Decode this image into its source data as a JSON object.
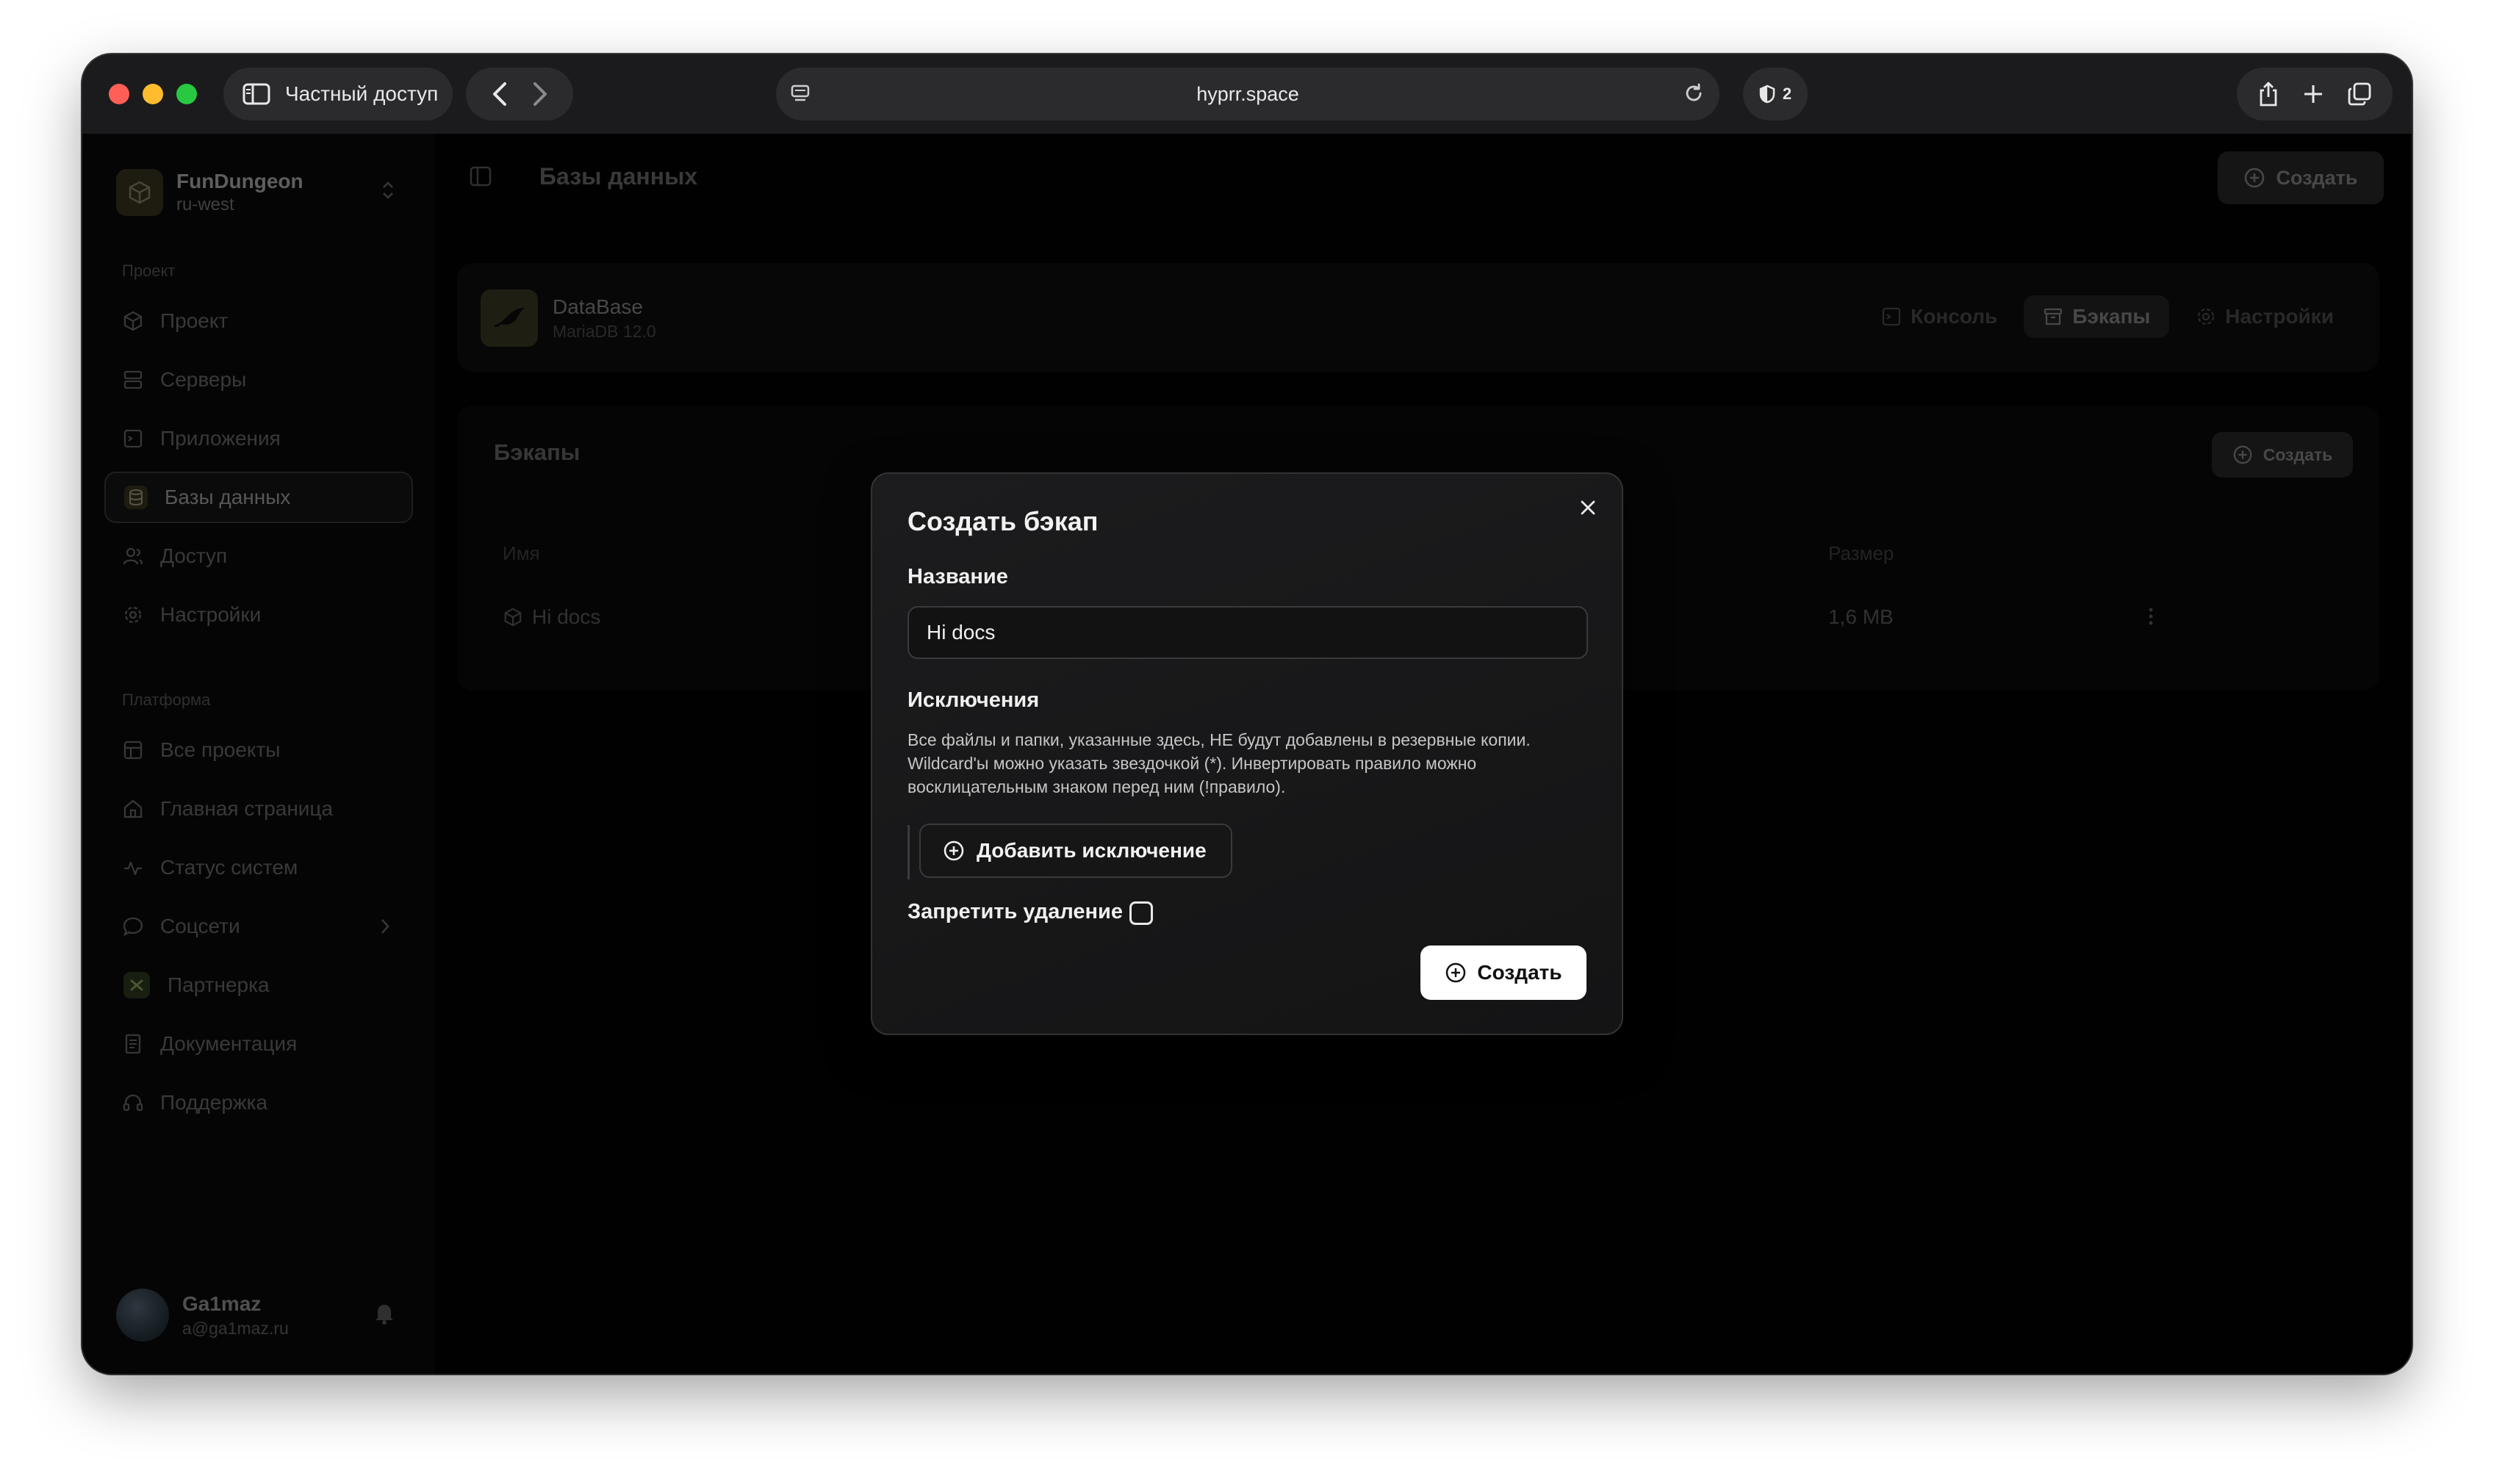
{
  "browser": {
    "sidebar_label": "Частный доступ",
    "url": "hyprr.space",
    "shield_count": "2"
  },
  "workspace": {
    "name": "FunDungeon",
    "region": "ru-west"
  },
  "sidebar": {
    "project_section": "Проект",
    "project_items": [
      {
        "label": "Проект",
        "icon": "cube-icon"
      },
      {
        "label": "Серверы",
        "icon": "server-icon"
      },
      {
        "label": "Приложения",
        "icon": "app-icon"
      },
      {
        "label": "Базы данных",
        "icon": "database-icon",
        "active": true
      },
      {
        "label": "Доступ",
        "icon": "users-icon"
      },
      {
        "label": "Настройки",
        "icon": "gear-icon"
      }
    ],
    "platform_section": "Платформа",
    "platform_items": [
      {
        "label": "Все проекты",
        "icon": "grid-icon"
      },
      {
        "label": "Главная страница",
        "icon": "home-icon"
      },
      {
        "label": "Статус систем",
        "icon": "activity-icon"
      },
      {
        "label": "Соцсети",
        "icon": "chat-icon"
      },
      {
        "label": "Партнерка",
        "icon": "partner-icon"
      },
      {
        "label": "Документация",
        "icon": "doc-icon"
      },
      {
        "label": "Поддержка",
        "icon": "headset-icon"
      }
    ]
  },
  "user": {
    "name": "Ga1maz",
    "email": "a@ga1maz.ru"
  },
  "header": {
    "title": "Базы данных",
    "create_label": "Создать"
  },
  "database": {
    "name": "DataBase",
    "version": "MariaDB 12.0",
    "tabs": [
      "Консоль",
      "Бэкапы",
      "Настройки"
    ]
  },
  "backups": {
    "title": "Бэкапы",
    "create_label": "Создать",
    "columns": {
      "name": "Имя",
      "size": "Размер"
    },
    "rows": [
      {
        "name": "Hi docs",
        "size": "1,6 MB"
      }
    ]
  },
  "modal": {
    "title": "Создать бэкап",
    "name_label": "Название",
    "name_value": "Hi docs",
    "exclusions_label": "Исключения",
    "exclusions_desc": "Все файлы и папки, указанные здесь, НЕ будут добавлены в резервные копии. Wildcard'ы можно указать звездочкой (*). Инвертировать правило можно восклицательным знаком перед ним (!правило).",
    "add_exclusion_label": "Добавить исключение",
    "prevent_delete_label": "Запретить удаление",
    "submit_label": "Создать"
  },
  "colors": {
    "window_bg": "#000000",
    "accent_submit": "#ffffff",
    "traffic_red": "#ff5f57",
    "traffic_yellow": "#febc2e",
    "traffic_green": "#28c840"
  }
}
